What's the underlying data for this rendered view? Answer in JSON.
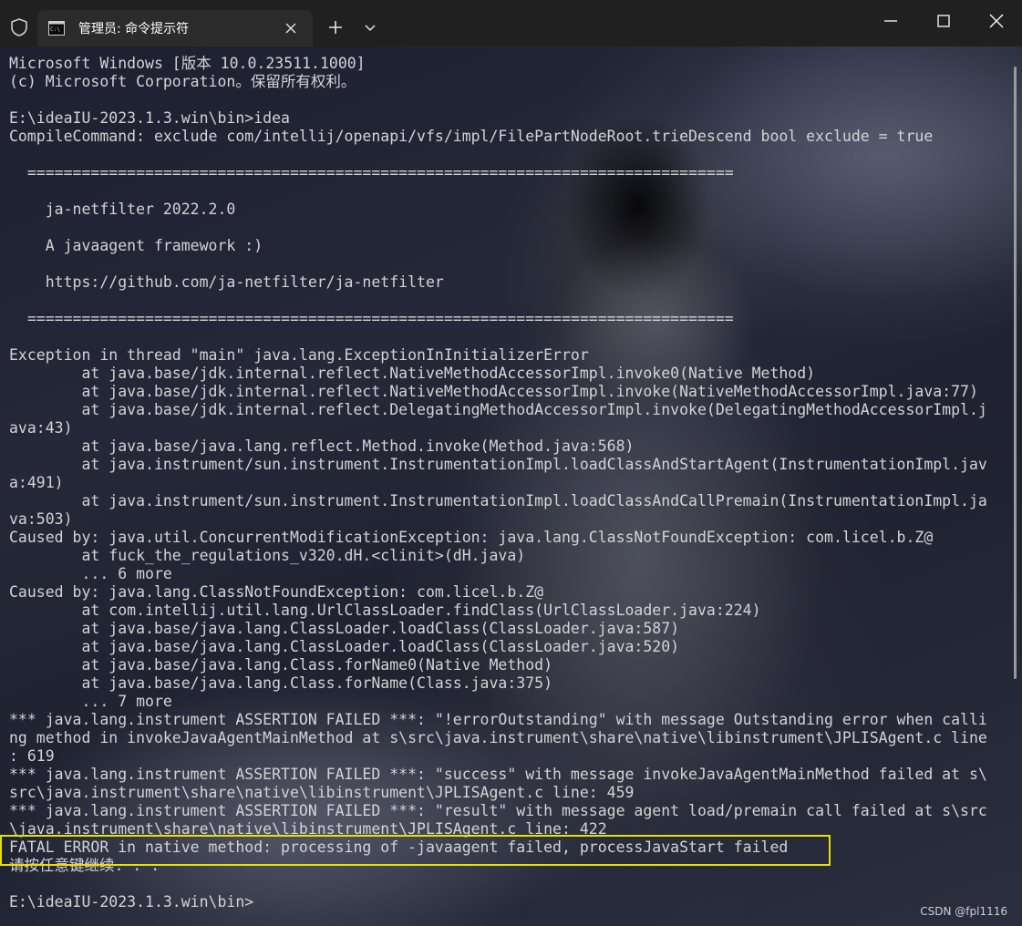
{
  "window": {
    "tab_title": "管理员: 命令提示符",
    "icons": {
      "shield": "shield-icon",
      "tab": "terminal-icon",
      "close_tab": "close-icon",
      "new_tab": "plus-icon",
      "dropdown": "chevron-down-icon",
      "minimize": "minimize-icon",
      "maximize": "maximize-icon",
      "close": "close-icon"
    }
  },
  "terminal": {
    "lines": [
      "Microsoft Windows [版本 10.0.23511.1000]",
      "(c) Microsoft Corporation。保留所有权利。",
      "",
      "E:\\ideaIU-2023.1.3.win\\bin>idea",
      "CompileCommand: exclude com/intellij/openapi/vfs/impl/FilePartNodeRoot.trieDescend bool exclude = true",
      "",
      "  ==============================================================================",
      "",
      "    ja-netfilter 2022.2.0",
      "",
      "    A javaagent framework :)",
      "",
      "    https://github.com/ja-netfilter/ja-netfilter",
      "",
      "  ==============================================================================",
      "",
      "Exception in thread \"main\" java.lang.ExceptionInInitializerError",
      "        at java.base/jdk.internal.reflect.NativeMethodAccessorImpl.invoke0(Native Method)",
      "        at java.base/jdk.internal.reflect.NativeMethodAccessorImpl.invoke(NativeMethodAccessorImpl.java:77)",
      "        at java.base/jdk.internal.reflect.DelegatingMethodAccessorImpl.invoke(DelegatingMethodAccessorImpl.j",
      "ava:43)",
      "        at java.base/java.lang.reflect.Method.invoke(Method.java:568)",
      "        at java.instrument/sun.instrument.InstrumentationImpl.loadClassAndStartAgent(InstrumentationImpl.jav",
      "a:491)",
      "        at java.instrument/sun.instrument.InstrumentationImpl.loadClassAndCallPremain(InstrumentationImpl.ja",
      "va:503)",
      "Caused by: java.util.ConcurrentModificationException: java.lang.ClassNotFoundException: com.licel.b.Z@",
      "        at fuck_the_regulations_v320.dH.<clinit>(dH.java)",
      "        ... 6 more",
      "Caused by: java.lang.ClassNotFoundException: com.licel.b.Z@",
      "        at com.intellij.util.lang.UrlClassLoader.findClass(UrlClassLoader.java:224)",
      "        at java.base/java.lang.ClassLoader.loadClass(ClassLoader.java:587)",
      "        at java.base/java.lang.ClassLoader.loadClass(ClassLoader.java:520)",
      "        at java.base/java.lang.Class.forName0(Native Method)",
      "        at java.base/java.lang.Class.forName(Class.java:375)",
      "        ... 7 more",
      "*** java.lang.instrument ASSERTION FAILED ***: \"!errorOutstanding\" with message Outstanding error when calli",
      "ng method in invokeJavaAgentMainMethod at s\\src\\java.instrument\\share\\native\\libinstrument\\JPLISAgent.c line",
      ": 619",
      "*** java.lang.instrument ASSERTION FAILED ***: \"success\" with message invokeJavaAgentMainMethod failed at s\\",
      "src\\java.instrument\\share\\native\\libinstrument\\JPLISAgent.c line: 459",
      "*** java.lang.instrument ASSERTION FAILED ***: \"result\" with message agent load/premain call failed at s\\src",
      "\\java.instrument\\share\\native\\libinstrument\\JPLISAgent.c line: 422",
      "FATAL ERROR in native method: processing of -javaagent failed, processJavaStart failed",
      "请按任意键继续. . .",
      "",
      "E:\\ideaIU-2023.1.3.win\\bin>"
    ]
  },
  "watermark": "CSDN @fpl1116",
  "colors": {
    "titlebar": "#202020",
    "tab": "#2b2b2b",
    "text": "#d4d4d4",
    "highlight": "#e8e000"
  }
}
